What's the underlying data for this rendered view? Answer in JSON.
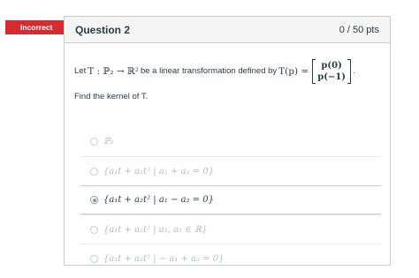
{
  "status_tag": "Incorrect",
  "question": {
    "title": "Question 2",
    "points": "0 / 50 pts",
    "statement_prefix": "Let",
    "statement_map": "T : ℙ₂ → ℝ²",
    "statement_mid": "be a linear transformation defined by",
    "statement_tp": "T(p) =",
    "matrix_top": "p(0)",
    "matrix_bottom": "p(−1)",
    "statement_end": ".",
    "prompt": "Find the kernel of T."
  },
  "answers": [
    {
      "text": "ℙ₂",
      "selected": false
    },
    {
      "text": "{a₁t + a₂t² | a₁ + a₂ = 0}",
      "selected": false
    },
    {
      "text": "{a₁t + a₂t² | a₁ − a₂ = 0}",
      "selected": true
    },
    {
      "text": "{a₁t + a₂t² | a₁, a₂ ∈ ℝ}",
      "selected": false
    },
    {
      "text": "{a₁t + a₂t² | − a₁ + a₂ = 0}",
      "selected": false
    }
  ]
}
